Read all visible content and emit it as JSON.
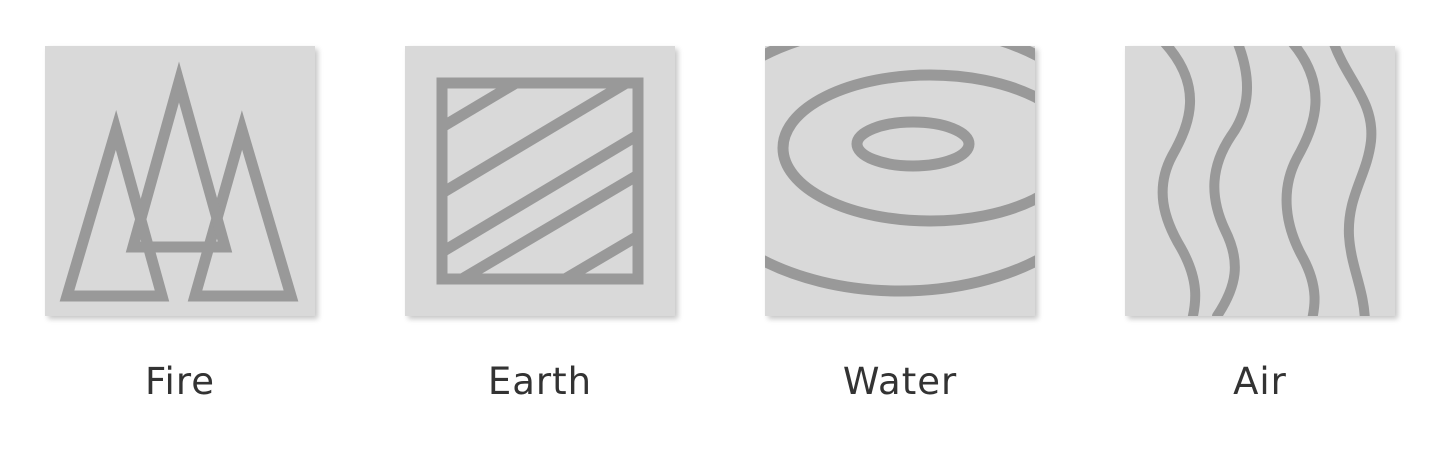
{
  "elements": [
    {
      "key": "fire",
      "label": "Fire",
      "icon": "trees-icon"
    },
    {
      "key": "earth",
      "label": "Earth",
      "icon": "hatched-square-icon"
    },
    {
      "key": "water",
      "label": "Water",
      "icon": "ripples-icon"
    },
    {
      "key": "air",
      "label": "Air",
      "icon": "waves-icon"
    }
  ],
  "colors": {
    "tile_background": "#d9d9d9",
    "stroke": "#999999",
    "label_text": "#333333"
  }
}
